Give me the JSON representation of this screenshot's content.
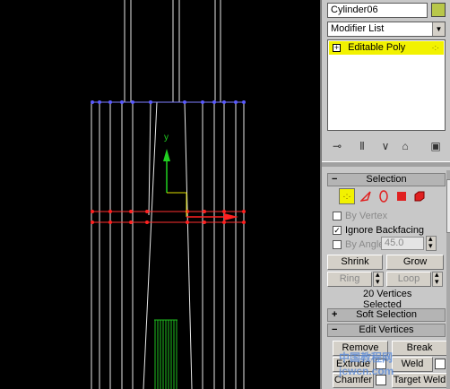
{
  "object_name": "Cylinder06",
  "object_color": "#b8c74a",
  "modifier_list": {
    "label": "Modifier List"
  },
  "stack": {
    "items": [
      {
        "label": "Editable Poly"
      }
    ]
  },
  "selection_rollout": {
    "title": "Selection",
    "sub_object_icons": [
      "vertex-icon",
      "edge-icon",
      "border-icon",
      "polygon-icon",
      "element-icon"
    ],
    "by_vertex_label": "By Vertex",
    "ignore_backfacing_label": "Ignore Backfacing",
    "by_angle_label": "By Angle:",
    "angle_value": "45.0",
    "shrink_label": "Shrink",
    "grow_label": "Grow",
    "ring_label": "Ring",
    "loop_label": "Loop",
    "status": "20 Vertices Selected"
  },
  "soft_selection": {
    "title": "Soft Selection"
  },
  "edit_vertices": {
    "title": "Edit Vertices",
    "remove_label": "Remove",
    "break_label": "Break",
    "extrude_label": "Extrude",
    "weld_label": "Weld",
    "chamfer_label": "Chamfer",
    "target_weld_label": "Target Weld"
  },
  "viewport": {
    "gizmo_y_label": "y"
  },
  "watermark": "中国教程网 jcwcn.com"
}
